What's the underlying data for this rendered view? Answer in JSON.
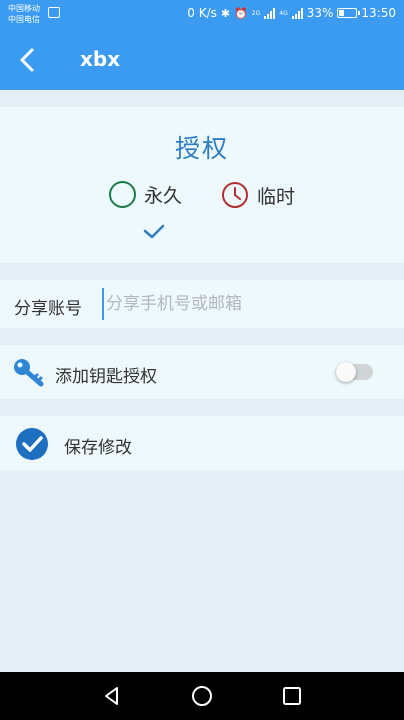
{
  "status_bar": {
    "carrier_1": "中国移动",
    "carrier_2": "中国电信",
    "net_speed": "0 K/s",
    "network_1": "2G",
    "network_2": "4G",
    "battery": "33%",
    "battery_level": 0.33,
    "time": "13:50"
  },
  "app_bar": {
    "title": "xbx",
    "back_icon": "chevron-left-icon"
  },
  "authorization": {
    "title": "授权",
    "options": [
      {
        "label": "永久",
        "icon": "circle-icon",
        "selected": true
      },
      {
        "label": "临时",
        "icon": "clock-icon",
        "selected": false
      }
    ]
  },
  "share": {
    "label": "分享账号",
    "placeholder": "分享手机号或邮箱",
    "value": ""
  },
  "key_auth": {
    "label": "添加钥匙授权",
    "icon": "key-icon",
    "enabled": false
  },
  "save": {
    "label": "保存修改",
    "icon": "check-circle-icon"
  },
  "nav_bar": {
    "buttons": [
      "back-triangle-icon",
      "home-circle-icon",
      "recents-square-icon"
    ]
  },
  "colors": {
    "primary": "#3a9bf0",
    "background": "#e3eff4",
    "panel": "#edf9fc",
    "title_blue": "#2f7dc1",
    "green": "#1e7a47",
    "red": "#b0312f"
  }
}
